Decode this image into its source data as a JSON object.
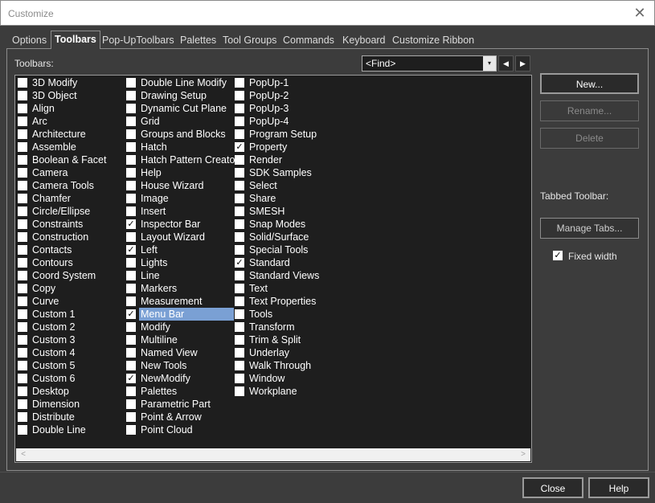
{
  "window": {
    "title": "Customize",
    "close_glyph": "✕",
    "close_icon": "close-icon"
  },
  "tabs": [
    {
      "label": "Options",
      "active": false
    },
    {
      "label": "Toolbars",
      "active": true
    },
    {
      "label": "Pop-UpToolbars",
      "active": false
    },
    {
      "label": "Palettes",
      "active": false
    },
    {
      "label": "Tool Groups",
      "active": false
    },
    {
      "label": "Commands",
      "active": false
    },
    {
      "label": "Keyboard",
      "active": false
    },
    {
      "label": "Customize Ribbon",
      "active": false
    }
  ],
  "toolbars_label": "Toolbars:",
  "find": {
    "value": "<Find>",
    "dropdown_glyph": "▾",
    "prev_glyph": "◀",
    "next_glyph": "▶"
  },
  "toolbars": [
    [
      {
        "label": "3D Modify",
        "checked": false
      },
      {
        "label": "3D Object",
        "checked": false
      },
      {
        "label": "Align",
        "checked": false
      },
      {
        "label": "Arc",
        "checked": false
      },
      {
        "label": "Architecture",
        "checked": false
      },
      {
        "label": "Assemble",
        "checked": false
      },
      {
        "label": "Boolean & Facet",
        "checked": false
      },
      {
        "label": "Camera",
        "checked": false
      },
      {
        "label": "Camera Tools",
        "checked": false
      },
      {
        "label": "Chamfer",
        "checked": false
      },
      {
        "label": "Circle/Ellipse",
        "checked": false
      },
      {
        "label": "Constraints",
        "checked": false
      },
      {
        "label": "Construction",
        "checked": false
      },
      {
        "label": "Contacts",
        "checked": false
      },
      {
        "label": "Contours",
        "checked": false
      },
      {
        "label": "Coord System",
        "checked": false
      },
      {
        "label": "Copy",
        "checked": false
      },
      {
        "label": "Curve",
        "checked": false
      },
      {
        "label": "Custom 1",
        "checked": false
      },
      {
        "label": "Custom 2",
        "checked": false
      },
      {
        "label": "Custom 3",
        "checked": false
      },
      {
        "label": "Custom 4",
        "checked": false
      },
      {
        "label": "Custom 5",
        "checked": false
      },
      {
        "label": "Custom 6",
        "checked": false
      },
      {
        "label": "Desktop",
        "checked": false
      },
      {
        "label": "Dimension",
        "checked": false
      },
      {
        "label": "Distribute",
        "checked": false
      },
      {
        "label": "Double Line",
        "checked": false
      }
    ],
    [
      {
        "label": "Double Line Modify",
        "checked": false
      },
      {
        "label": "Drawing Setup",
        "checked": false
      },
      {
        "label": "Dynamic Cut Plane",
        "checked": false
      },
      {
        "label": "Grid",
        "checked": false
      },
      {
        "label": "Groups and Blocks",
        "checked": false
      },
      {
        "label": "Hatch",
        "checked": false
      },
      {
        "label": "Hatch Pattern Creator",
        "checked": false
      },
      {
        "label": "Help",
        "checked": false
      },
      {
        "label": "House Wizard",
        "checked": false
      },
      {
        "label": "Image",
        "checked": false
      },
      {
        "label": "Insert",
        "checked": false
      },
      {
        "label": "Inspector Bar",
        "checked": true
      },
      {
        "label": "Layout Wizard",
        "checked": false
      },
      {
        "label": "Left",
        "checked": true
      },
      {
        "label": "Lights",
        "checked": false
      },
      {
        "label": "Line",
        "checked": false
      },
      {
        "label": "Markers",
        "checked": false
      },
      {
        "label": "Measurement",
        "checked": false
      },
      {
        "label": "Menu Bar",
        "checked": true,
        "selected": true
      },
      {
        "label": "Modify",
        "checked": false
      },
      {
        "label": "Multiline",
        "checked": false
      },
      {
        "label": "Named View",
        "checked": false
      },
      {
        "label": "New Tools",
        "checked": false
      },
      {
        "label": "NewModify",
        "checked": true
      },
      {
        "label": "Palettes",
        "checked": false
      },
      {
        "label": "Parametric Part",
        "checked": false
      },
      {
        "label": "Point & Arrow",
        "checked": false
      },
      {
        "label": "Point Cloud",
        "checked": false
      }
    ],
    [
      {
        "label": "PopUp-1",
        "checked": false
      },
      {
        "label": "PopUp-2",
        "checked": false
      },
      {
        "label": "PopUp-3",
        "checked": false
      },
      {
        "label": "PopUp-4",
        "checked": false
      },
      {
        "label": "Program Setup",
        "checked": false
      },
      {
        "label": "Property",
        "checked": true
      },
      {
        "label": "Render",
        "checked": false
      },
      {
        "label": "SDK Samples",
        "checked": false
      },
      {
        "label": "Select",
        "checked": false
      },
      {
        "label": "Share",
        "checked": false
      },
      {
        "label": "SMESH",
        "checked": false
      },
      {
        "label": "Snap Modes",
        "checked": false
      },
      {
        "label": "Solid/Surface",
        "checked": false
      },
      {
        "label": "Special Tools",
        "checked": false
      },
      {
        "label": "Standard",
        "checked": true
      },
      {
        "label": "Standard Views",
        "checked": false
      },
      {
        "label": "Text",
        "checked": false
      },
      {
        "label": "Text Properties",
        "checked": false
      },
      {
        "label": "Tools",
        "checked": false
      },
      {
        "label": "Transform",
        "checked": false
      },
      {
        "label": "Trim & Split",
        "checked": false
      },
      {
        "label": "Underlay",
        "checked": false
      },
      {
        "label": "Walk Through",
        "checked": false
      },
      {
        "label": "Window",
        "checked": false
      },
      {
        "label": "Workplane",
        "checked": false
      }
    ]
  ],
  "scroll": {
    "left_glyph": "<",
    "right_glyph": ">"
  },
  "buttons": {
    "new": "New...",
    "rename": "Rename...",
    "delete": "Delete",
    "manage_tabs": "Manage Tabs..."
  },
  "tabbed_toolbar_label": "Tabbed Toolbar:",
  "fixed_width": {
    "label": "Fixed width",
    "checked": true
  },
  "footer": {
    "close": "Close",
    "help": "Help"
  },
  "check_glyph": "✓"
}
